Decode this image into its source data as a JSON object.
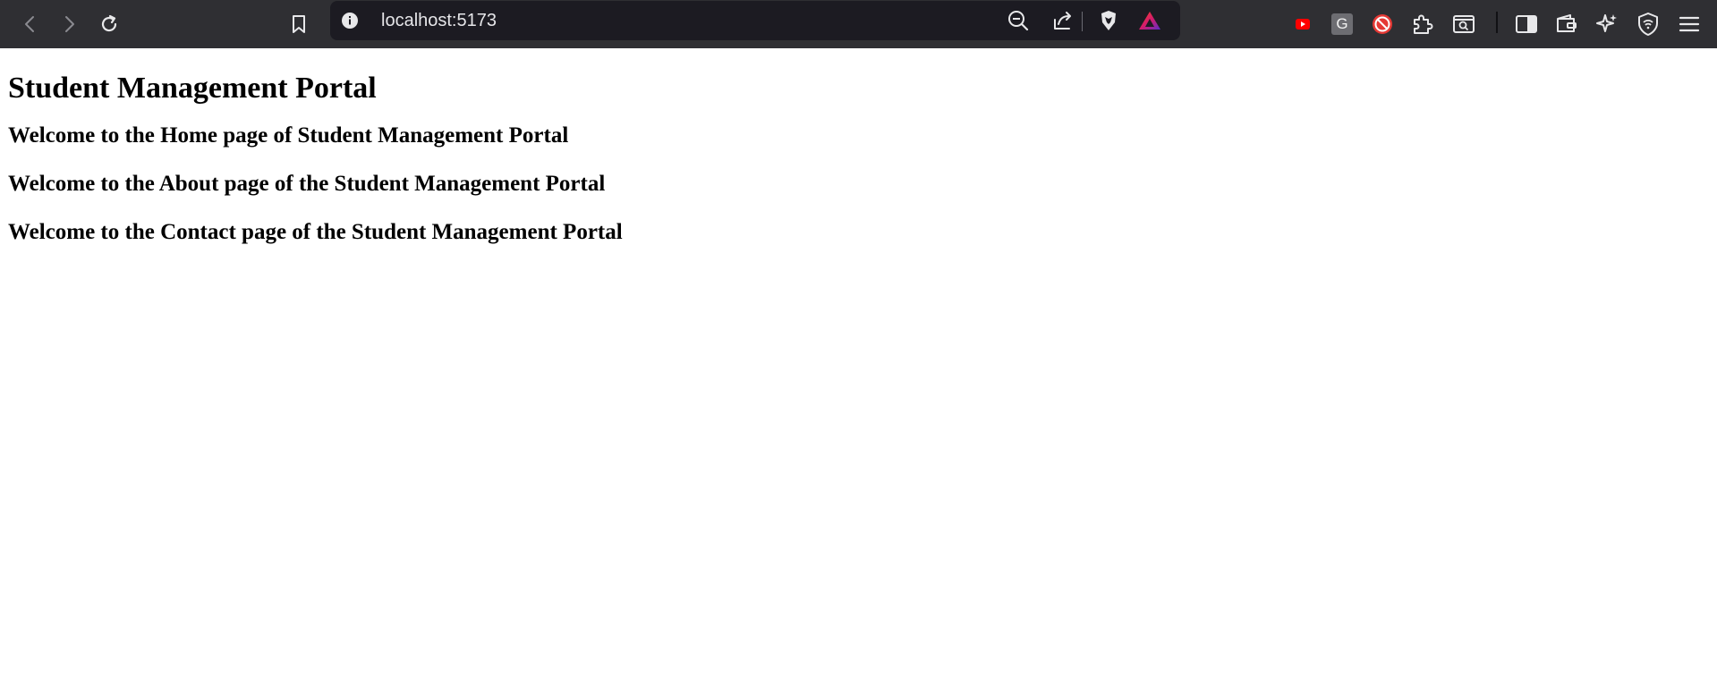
{
  "browser": {
    "url": "localhost:5173",
    "icons": {
      "back": "back-arrow-icon",
      "forward": "forward-arrow-icon",
      "reload": "reload-icon",
      "bookmark": "bookmark-icon",
      "site_info": "info-icon",
      "zoom": "zoom-out-icon",
      "share": "share-icon",
      "brave_shields": "brave-shields-icon",
      "brave_rewards": "brave-rewards-icon",
      "ext_youtube": "youtube-extension-icon",
      "ext_g": "g-extension-icon",
      "ext_blocker": "blocker-extension-icon",
      "extensions": "puzzle-extensions-icon",
      "search_tab": "search-tab-icon",
      "sidebar": "sidebar-icon",
      "wallet": "wallet-icon",
      "leo": "sparkle-ai-icon",
      "vpn": "vpn-shield-icon",
      "menu": "hamburger-menu-icon"
    },
    "ext_g_label": "G",
    "colors": {
      "toolbar_bg": "#2f2f33",
      "urlbar_bg": "#1c1b22",
      "icon": "#e8e8ea",
      "youtube_red": "#ff0000",
      "blocker_red": "#e53935"
    }
  },
  "page": {
    "title": "Student Management Portal",
    "sections": [
      "Welcome to the Home page of Student Management Portal",
      "Welcome to the About page of the Student Management Portal",
      "Welcome to the Contact page of the Student Management Portal"
    ]
  }
}
